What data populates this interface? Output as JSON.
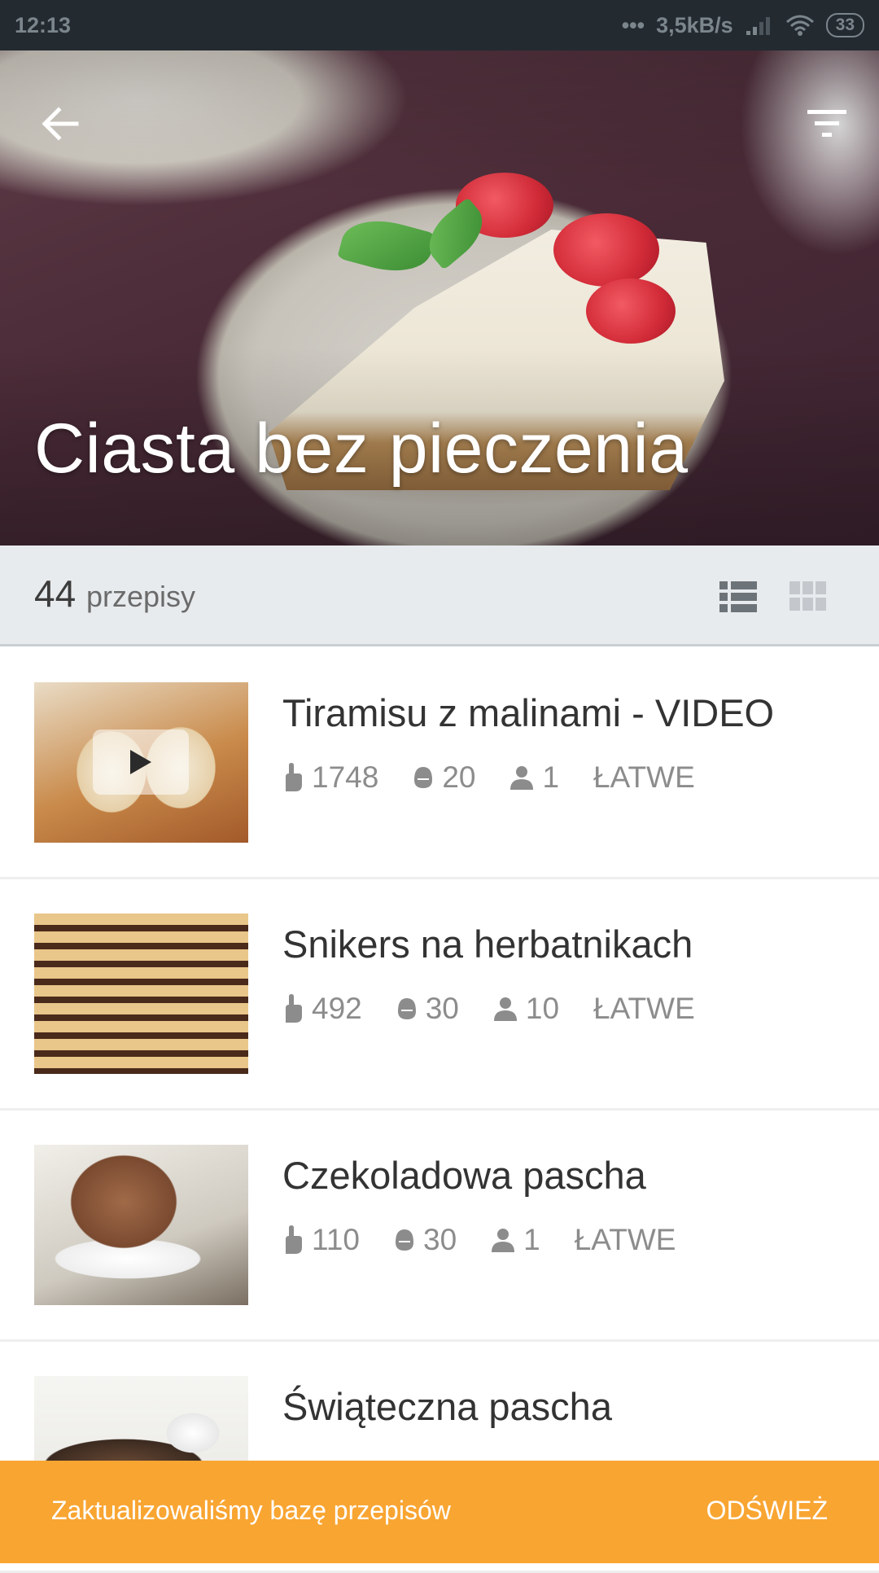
{
  "status_bar": {
    "time": "12:13",
    "network_speed": "3,5kB/s",
    "battery": "33"
  },
  "hero": {
    "title": "Ciasta bez pieczenia"
  },
  "recipes_header": {
    "count": "44",
    "count_label": "przepisy"
  },
  "recipes": [
    {
      "title": "Tiramisu z malinami - VIDEO",
      "likes": "1748",
      "time": "20",
      "servings": "1",
      "difficulty": "ŁATWE",
      "has_video": true
    },
    {
      "title": "Snikers na herbatnikach",
      "likes": "492",
      "time": "30",
      "servings": "10",
      "difficulty": "ŁATWE",
      "has_video": false
    },
    {
      "title": "Czekoladowa pascha",
      "likes": "110",
      "time": "30",
      "servings": "1",
      "difficulty": "ŁATWE",
      "has_video": false
    },
    {
      "title": "Świąteczna pascha",
      "likes": "",
      "time": "",
      "servings": "",
      "difficulty": "",
      "has_video": false
    }
  ],
  "snackbar": {
    "message": "Zaktualizowaliśmy bazę przepisów",
    "action": "ODŚWIEŻ"
  },
  "colors": {
    "status_bar_bg": "#232a30",
    "count_bar_bg": "#e8ebee",
    "snackbar_bg": "#f9a532",
    "meta_text": "#8c8c8c"
  }
}
